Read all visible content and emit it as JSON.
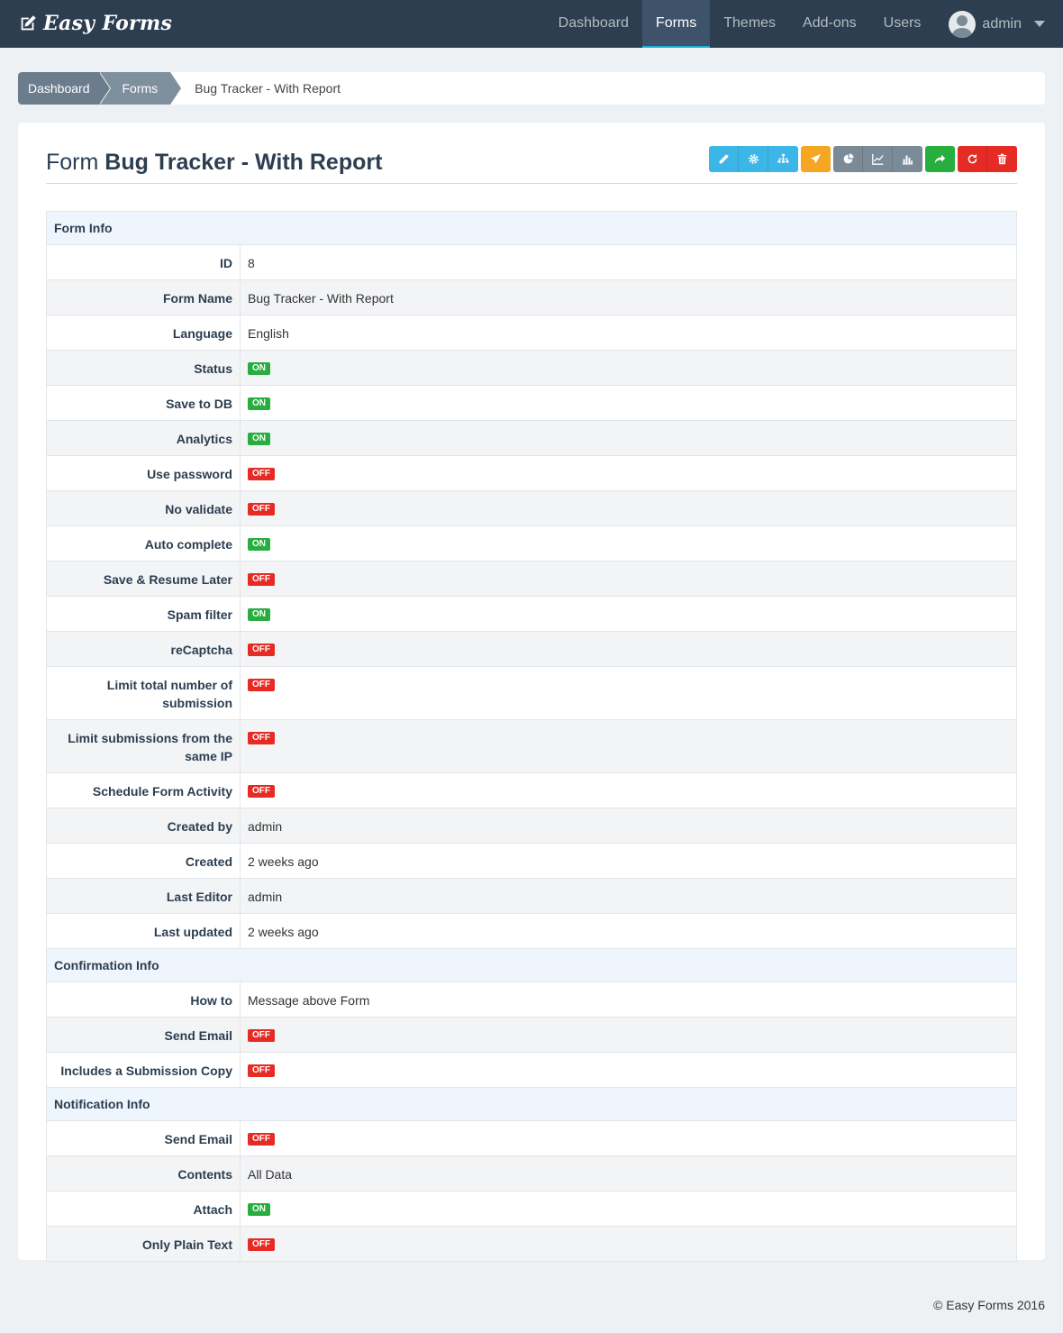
{
  "brand": {
    "name": "Easy Forms"
  },
  "nav": {
    "items": [
      {
        "label": "Dashboard",
        "active": false
      },
      {
        "label": "Forms",
        "active": true
      },
      {
        "label": "Themes",
        "active": false
      },
      {
        "label": "Add-ons",
        "active": false
      },
      {
        "label": "Users",
        "active": false
      }
    ],
    "user": "admin"
  },
  "breadcrumb": {
    "items": [
      "Dashboard",
      "Forms"
    ],
    "current": "Bug Tracker - With Report"
  },
  "page": {
    "title_prefix": "Form",
    "title_name": "Bug Tracker - With Report"
  },
  "toolbar": {
    "groups": [
      {
        "color": "#3bb6e6",
        "buttons": [
          "pencil-icon",
          "gear-icon",
          "sitemap-icon"
        ]
      },
      {
        "color": "#f5a623",
        "buttons": [
          "send-icon"
        ]
      },
      {
        "color": "#7b8a97",
        "buttons": [
          "pie-chart-icon",
          "line-chart-icon",
          "bar-chart-icon"
        ]
      },
      {
        "color": "#27ae3f",
        "buttons": [
          "share-icon"
        ]
      },
      {
        "color": "#e52b24",
        "buttons": [
          "refresh-icon",
          "trash-icon"
        ]
      }
    ]
  },
  "status_colors": {
    "on": "#27ae3f",
    "off": "#e52b24"
  },
  "sections": [
    {
      "title": "Form Info",
      "rows": [
        {
          "label": "ID",
          "value": "8"
        },
        {
          "label": "Form Name",
          "value": "Bug Tracker - With Report"
        },
        {
          "label": "Language",
          "value": "English"
        },
        {
          "label": "Status",
          "badge": "ON"
        },
        {
          "label": "Save to DB",
          "badge": "ON"
        },
        {
          "label": "Analytics",
          "badge": "ON"
        },
        {
          "label": "Use password",
          "badge": "OFF"
        },
        {
          "label": "No validate",
          "badge": "OFF"
        },
        {
          "label": "Auto complete",
          "badge": "ON"
        },
        {
          "label": "Save & Resume Later",
          "badge": "OFF"
        },
        {
          "label": "Spam filter",
          "badge": "ON"
        },
        {
          "label": "reCaptcha",
          "badge": "OFF"
        },
        {
          "label": "Limit total number of submission",
          "badge": "OFF"
        },
        {
          "label": "Limit submissions from the same IP",
          "badge": "OFF"
        },
        {
          "label": "Schedule Form Activity",
          "badge": "OFF"
        },
        {
          "label": "Created by",
          "value": "admin"
        },
        {
          "label": "Created",
          "value": "2 weeks ago"
        },
        {
          "label": "Last Editor",
          "value": "admin"
        },
        {
          "label": "Last updated",
          "value": "2 weeks ago"
        }
      ]
    },
    {
      "title": "Confirmation Info",
      "rows": [
        {
          "label": "How to",
          "value": "Message above Form"
        },
        {
          "label": "Send Email",
          "badge": "OFF"
        },
        {
          "label": "Includes a Submission Copy",
          "badge": "OFF"
        }
      ]
    },
    {
      "title": "Notification Info",
      "rows": [
        {
          "label": "Send Email",
          "badge": "OFF"
        },
        {
          "label": "Contents",
          "value": "All Data"
        },
        {
          "label": "Attach",
          "badge": "ON"
        },
        {
          "label": "Only Plain Text",
          "badge": "OFF"
        }
      ]
    }
  ],
  "footer": {
    "text": "© Easy Forms 2016"
  }
}
